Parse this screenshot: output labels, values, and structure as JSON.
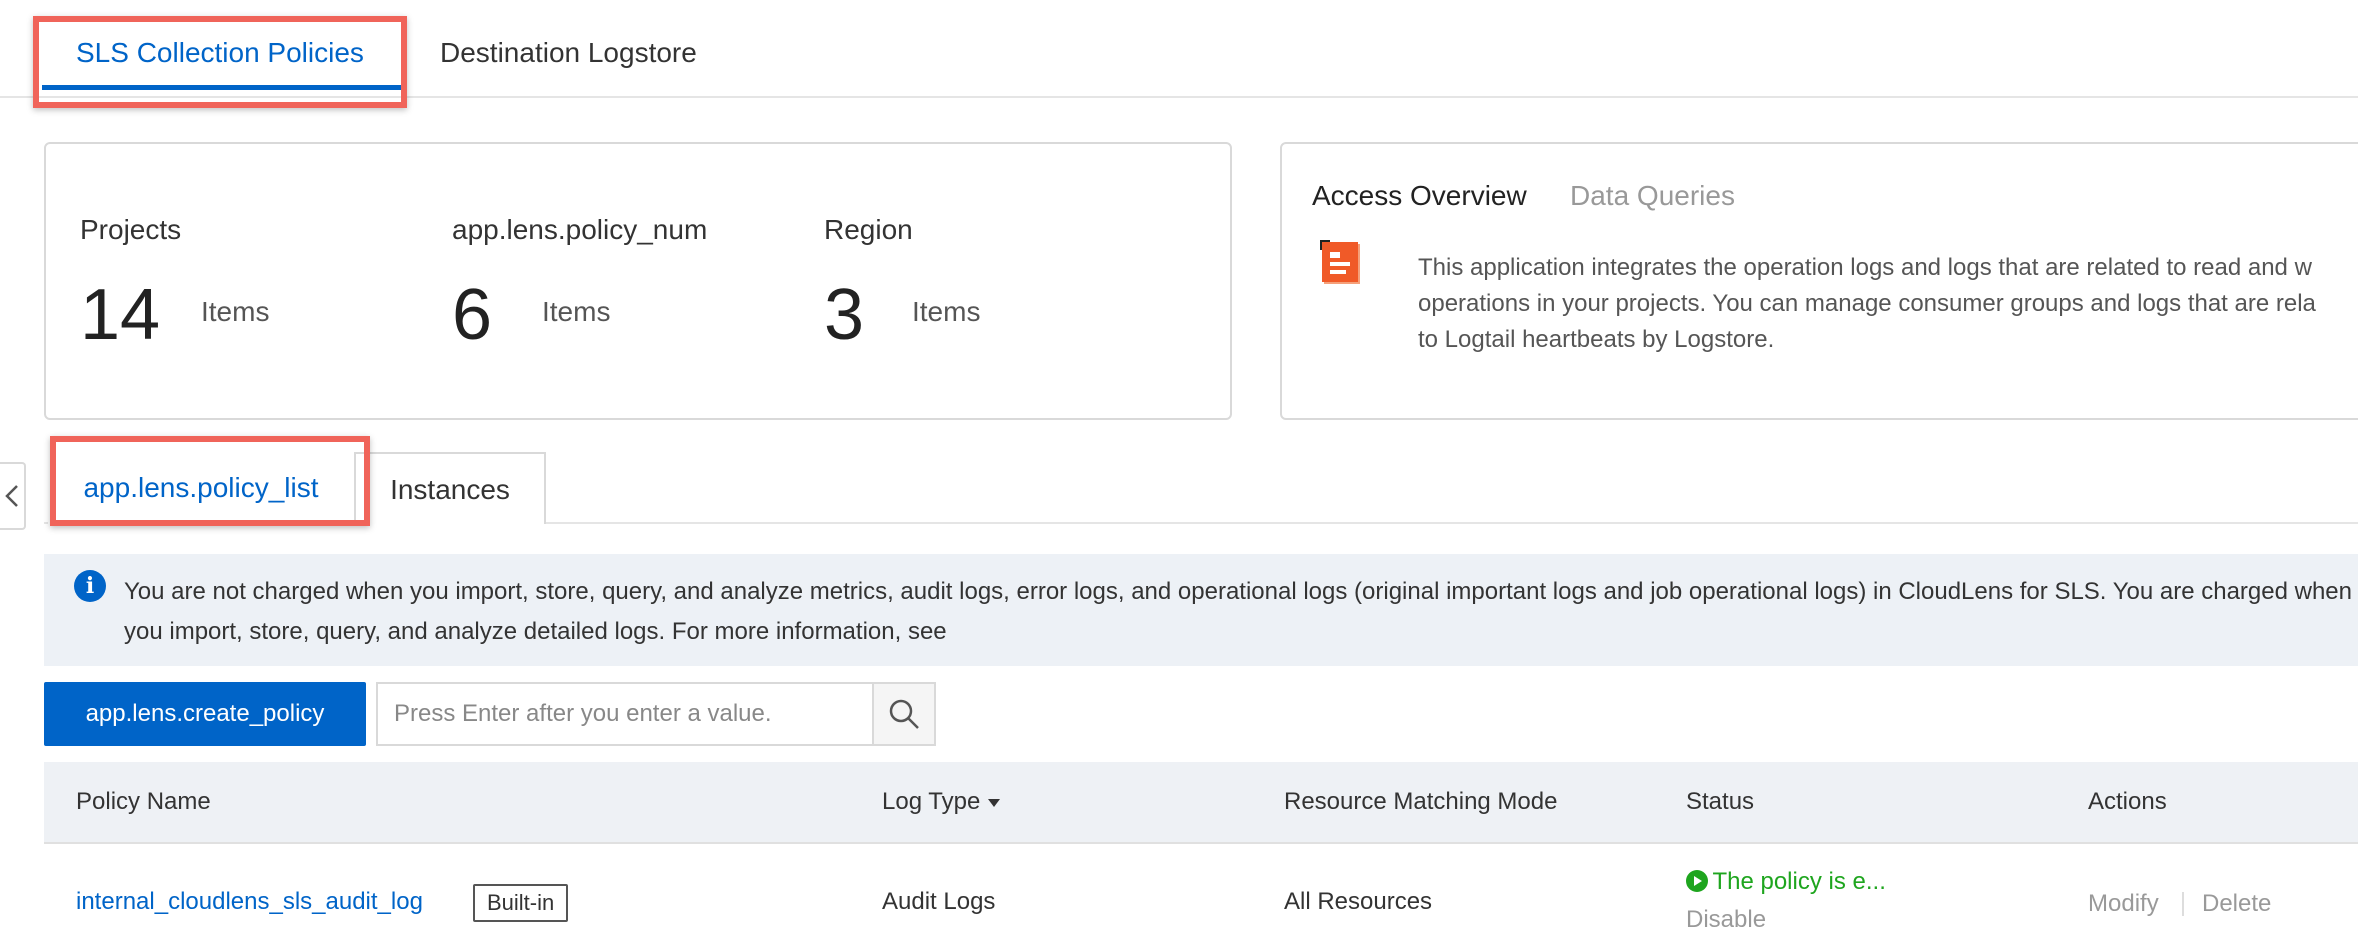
{
  "top_tabs": [
    {
      "label": "SLS Collection Policies",
      "active": true
    },
    {
      "label": "Destination Logstore",
      "active": false
    }
  ],
  "stats": [
    {
      "label": "Projects",
      "value": "14",
      "unit": "Items"
    },
    {
      "label": "app.lens.policy_num",
      "value": "6",
      "unit": "Items"
    },
    {
      "label": "Region",
      "value": "3",
      "unit": "Items"
    }
  ],
  "overview": {
    "tabs": [
      "Access Overview",
      "Data Queries"
    ],
    "lines": [
      "This application integrates the operation logs and logs that are related to read and w",
      "operations in your projects. You can manage consumer groups and logs that are rela",
      "to Logtail heartbeats by Logstore."
    ]
  },
  "sub_tabs": [
    {
      "label": "app.lens.policy_list",
      "active": true
    },
    {
      "label": "Instances",
      "active": false
    }
  ],
  "notice": {
    "text": "You are not charged when you import, store, query, and analyze metrics, audit logs, error logs, and operational logs (original important logs and job operational logs) in CloudLens for SLS. You are charged when you import, store, query, and analyze detailed logs. For more information, see"
  },
  "toolbar": {
    "create_label": "app.lens.create_policy",
    "search_placeholder": "Press Enter after you enter a value."
  },
  "table": {
    "columns": [
      "Policy Name",
      "Log Type",
      "Resource Matching Mode",
      "Status",
      "Actions"
    ],
    "rows": [
      {
        "name": "internal_cloudlens_sls_audit_log",
        "badge": "Built-in",
        "log_type": "Audit Logs",
        "mode": "All Resources",
        "status": "The policy is e...",
        "toggle": "Disable",
        "actions": [
          "Modify",
          "Delete"
        ]
      }
    ]
  },
  "colors": {
    "accent": "#0064c8",
    "highlight": "#f0645a",
    "success": "#1ea51e",
    "notice_bg": "#edf1f6"
  }
}
